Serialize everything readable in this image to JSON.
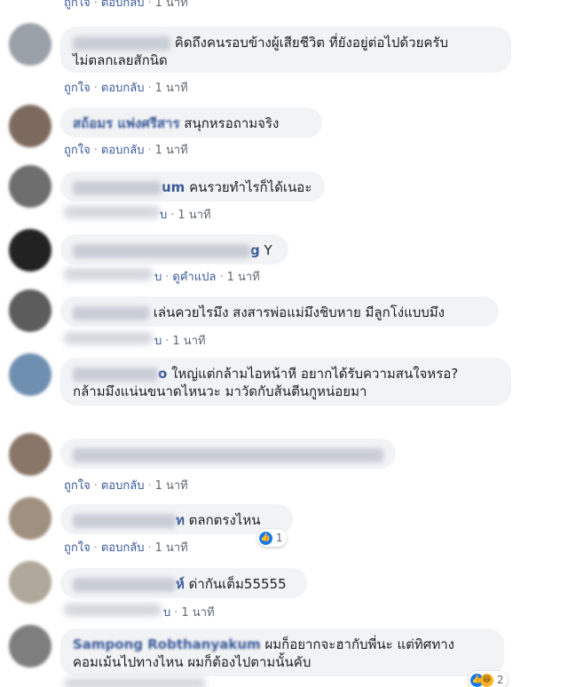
{
  "labels": {
    "like": "ถูกใจ",
    "reply": "ตอบกลับ",
    "time": "1 นาที",
    "translate": "ดูคำแปล"
  },
  "top_meta": {
    "like": "ถูกใจ",
    "reply": "ตอบกลับ",
    "time": "1 นาที"
  },
  "comments": [
    {
      "name_tail": "",
      "line1": "คิดถึงคนรอบข้างผู้เสียชีวิต ที่ยังอยู่ต่อไปด้วยครับ",
      "line2": "ไม่ตลกเลยสักนิด"
    },
    {
      "name_tail": "สถ้อมร แพ่งศรีสาร",
      "line1": "สนุกหรอถามจริง",
      "line2": ""
    },
    {
      "name_tail": "um",
      "line1": "คนรวยทำไรก็ได้เนอะ",
      "line2": ""
    },
    {
      "name_tail": "g",
      "line1": "Y",
      "line2": ""
    },
    {
      "name_tail": "",
      "line1": "เล่นควยไรมึง สงสารพ่อแม่มึงชิบหาย มีลูกโง่แบบมึง",
      "line2": ""
    },
    {
      "name_tail": "o",
      "line1": "ใหญ่แต่กล้ามไอหน้าหี อยากได้รับความสนใจหรอ?",
      "line2": "กล้ามมึงแน่นขนาดไหนวะ มาวัดกับส้นตีนกูหน่อยมา"
    },
    {
      "name_tail": "",
      "line1": "",
      "line2": ""
    },
    {
      "name_tail": "ท",
      "line1": "ตลกตรงไหน",
      "line2": "",
      "reactions": "1"
    },
    {
      "name_tail": "ห์",
      "line1": "ด่ากันเต็ม55555",
      "line2": ""
    },
    {
      "name_tail": "Sampong Robthanyakum",
      "line1": "ผมก็อยากจะฮากับพี่นะ แต่ทิศทาง",
      "line2": "คอมเม้นไปทางไหน ผมก็ต้องไปตามนั้นคับ",
      "reactions": "2"
    }
  ],
  "colors": {
    "name": "#385898",
    "bubble": "#f2f3f5",
    "like": "#1877f2"
  }
}
